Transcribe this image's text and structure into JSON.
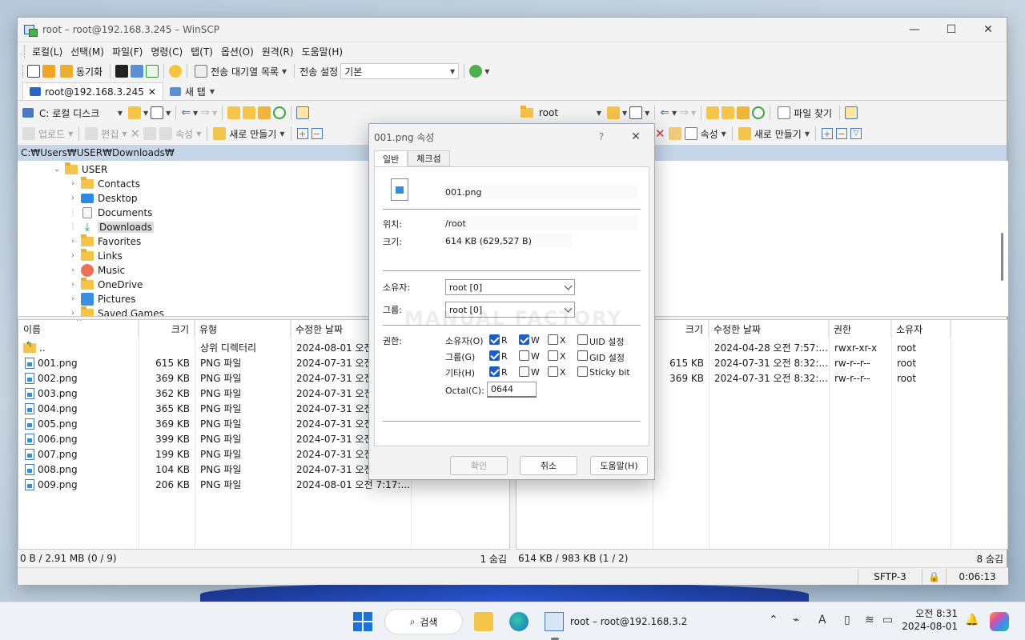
{
  "window": {
    "title": "root – root@192.168.3.245 – WinSCP",
    "minimize": "—",
    "maximize": "☐",
    "close": "✕"
  },
  "menu": [
    "로컬(L)",
    "선택(M)",
    "파일(F)",
    "명령(C)",
    "탭(T)",
    "옵션(O)",
    "원격(R)",
    "도움말(H)"
  ],
  "toolbar": {
    "sync": "동기화",
    "queue": "전송 대기열 목록",
    "transfer_settings_label": "전송 설정",
    "transfer_settings_value": "기본"
  },
  "tabs": {
    "session": "root@192.168.3.245",
    "new_tab": "새 탭"
  },
  "left": {
    "drive": "C: 로컬 디스크",
    "actions": {
      "upload": "업로드",
      "edit": "편집",
      "props": "속성",
      "new": "새로 만들기"
    },
    "path": "C:₩Users₩USER₩Downloads₩",
    "tree": [
      "USER",
      "Contacts",
      "Desktop",
      "Documents",
      "Downloads",
      "Favorites",
      "Links",
      "Music",
      "OneDrive",
      "Pictures",
      "Saved Games"
    ],
    "headers": {
      "name": "이름",
      "size": "크기",
      "type": "유형",
      "modified": "수정한 날짜"
    },
    "files": [
      {
        "name": "..",
        "size": "",
        "type": "상위 디렉터리",
        "date": "2024-08-01  오전"
      },
      {
        "name": "001.png",
        "size": "615 KB",
        "type": "PNG 파일",
        "date": "2024-07-31  오전"
      },
      {
        "name": "002.png",
        "size": "369 KB",
        "type": "PNG 파일",
        "date": "2024-07-31  오전"
      },
      {
        "name": "003.png",
        "size": "362 KB",
        "type": "PNG 파일",
        "date": "2024-07-31  오전"
      },
      {
        "name": "004.png",
        "size": "365 KB",
        "type": "PNG 파일",
        "date": "2024-07-31  오전"
      },
      {
        "name": "005.png",
        "size": "369 KB",
        "type": "PNG 파일",
        "date": "2024-07-31  오전"
      },
      {
        "name": "006.png",
        "size": "399 KB",
        "type": "PNG 파일",
        "date": "2024-07-31  오전"
      },
      {
        "name": "007.png",
        "size": "199 KB",
        "type": "PNG 파일",
        "date": "2024-07-31  오전"
      },
      {
        "name": "008.png",
        "size": "104 KB",
        "type": "PNG 파일",
        "date": "2024-07-31  오전"
      },
      {
        "name": "009.png",
        "size": "206 KB",
        "type": "PNG 파일",
        "date": "2024-08-01  오전 7:17:..."
      }
    ],
    "status_left": "0 B / 2.91 MB (0 / 9)",
    "status_right": "1 숨김"
  },
  "right": {
    "path_combo": "root",
    "find": "파일 찾기",
    "actions": {
      "props": "속성",
      "new": "새로 만들기"
    },
    "headers": {
      "size": "크기",
      "modified": "수정한 날짜",
      "perm": "권한",
      "owner": "소유자"
    },
    "files": [
      {
        "size": "",
        "date": "2024-04-28  오전 7:57:...",
        "perm": "rwxr-xr-x",
        "owner": "root"
      },
      {
        "size": "615 KB",
        "date": "2024-07-31  오전 8:32:...",
        "perm": "rw-r--r--",
        "owner": "root"
      },
      {
        "size": "369 KB",
        "date": "2024-07-31  오전 8:32:...",
        "perm": "rw-r--r--",
        "owner": "root"
      }
    ],
    "status_left": "614 KB / 983 KB (1 / 2)",
    "status_right": "8 숨김"
  },
  "statusbar": {
    "protocol": "SFTP-3",
    "elapsed": "0:06:13"
  },
  "dialog": {
    "title": "001.png 속성",
    "help": "?",
    "close": "✕",
    "tab_general": "일반",
    "tab_checksum": "체크섬",
    "filename": "001.png",
    "location_label": "위치:",
    "location": "/root",
    "size_label": "크기:",
    "size": "614 KB (629,527 B)",
    "owner_label": "소유자:",
    "owner": "root [0]",
    "group_label": "그룹:",
    "group": "root [0]",
    "perm_label": "권한:",
    "owner_row": "소유자(O)",
    "group_row": "그룹(G)",
    "others_row": "기타(H)",
    "r": "R",
    "w": "W",
    "x": "X",
    "uid": "UID 설정",
    "gid": "GID 설정",
    "sticky": "Sticky bit",
    "octal_label": "Octal(C):",
    "octal": "0644",
    "ok": "확인",
    "cancel": "취소",
    "helpbtn": "도움말(H)"
  },
  "watermark": "MANUAL FACTORY",
  "taskbar": {
    "search": "검색",
    "app": "root – root@192.168.3.2",
    "time": "오전 8:31",
    "date": "2024-08-01"
  }
}
